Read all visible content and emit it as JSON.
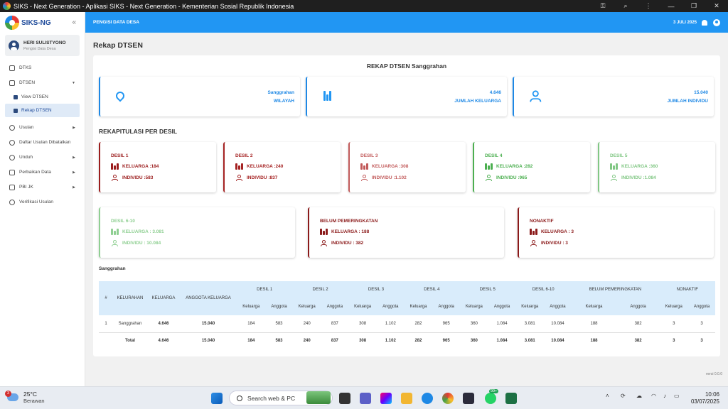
{
  "window": {
    "title": "SIKS - Next Generation - Aplikasi SIKS - Next Generation - Kementerian Sosial Republik Indonesia"
  },
  "sidebar": {
    "logo": "SIKS-NG",
    "user_name": "HERI SULISTYONO",
    "user_role": "Pengisi Data Desa",
    "items": [
      {
        "label": "DTKS"
      },
      {
        "label": "DTSEN"
      },
      {
        "label": "View DTSEN"
      },
      {
        "label": "Rekap DTSEN"
      },
      {
        "label": "Usulan"
      },
      {
        "label": "Daftar Usulan Dibatalkan"
      },
      {
        "label": "Unduh"
      },
      {
        "label": "Perbaikan Data"
      },
      {
        "label": "PBI JK"
      },
      {
        "label": "Verifikasi Usulan"
      }
    ]
  },
  "topbar": {
    "role": "PENGISI DATA DESA",
    "date": "3 JULI 2025"
  },
  "page": {
    "title": "Rekap DTSEN",
    "card_title": "REKAP DTSEN Sanggrahan",
    "section_title": "REKAPITULASI PER DESIL",
    "table_heading": "Sanggrahan",
    "version": "versi 0.0.0"
  },
  "summary": [
    {
      "value": "Sanggrahan",
      "label": "WILAYAH"
    },
    {
      "value": "4.646",
      "label": "JUMLAH KELUARGA"
    },
    {
      "value": "15.040",
      "label": "JUMLAH INDIVIDU"
    }
  ],
  "desil": [
    {
      "name": "DESIL 1",
      "keluarga": "KELUARGA :184",
      "individu": "INDIVIDU :583",
      "color": "#9b1c1c"
    },
    {
      "name": "DESIL 2",
      "keluarga": "KELUARGA :240",
      "individu": "INDIVIDU :837",
      "color": "#a52222"
    },
    {
      "name": "DESIL 3",
      "keluarga": "KELUARGA :308",
      "individu": "INDIVIDU :1.102",
      "color": "#c25b5b"
    },
    {
      "name": "DESIL 4",
      "keluarga": "KELUARGA :282",
      "individu": "INDIVIDU :965",
      "color": "#4caf50"
    },
    {
      "name": "DESIL 5",
      "keluarga": "KELUARGA :360",
      "individu": "INDIVIDU :1.084",
      "color": "#81c784"
    },
    {
      "name": "DESIL 6-10",
      "keluarga": "KELUARGA : 3.081",
      "individu": "INDIVIDU : 10.084",
      "color": "#8fcf92"
    },
    {
      "name": "BELUM PEMERINGKATAN",
      "keluarga": "KELUARGA : 188",
      "individu": "INDIVIDU : 382",
      "color": "#8b1a1a"
    },
    {
      "name": "NONAKTIF",
      "keluarga": "KELUARGA : 3",
      "individu": "INDIVIDU : 3",
      "color": "#8b1a1a"
    }
  ],
  "table": {
    "headers": {
      "no": "#",
      "kelurahan": "KELURAHAN",
      "keluarga": "KELUARGA",
      "anggota": "ANGGOTA KELUARGA"
    },
    "groups": [
      "DESIL 1",
      "DESIL 2",
      "DESIL 3",
      "DESIL 4",
      "DESIL 5",
      "DESIL 6-10",
      "BELUM PEMERINGKATAN",
      "NONAKTIF"
    ],
    "sub": {
      "keluarga": "Keluarga",
      "anggota": "Anggota"
    },
    "rows": [
      {
        "no": "1",
        "kelurahan": "Sanggrahan",
        "keluarga": "4.646",
        "anggota": "15.040",
        "cells": [
          "184",
          "583",
          "240",
          "837",
          "308",
          "1.102",
          "282",
          "965",
          "360",
          "1.084",
          "3.081",
          "10.084",
          "188",
          "382",
          "3",
          "3"
        ]
      },
      {
        "no": "",
        "kelurahan": "Total",
        "keluarga": "4.646",
        "anggota": "15.040",
        "cells": [
          "184",
          "583",
          "240",
          "837",
          "308",
          "1.102",
          "282",
          "965",
          "360",
          "1.084",
          "3.081",
          "10.084",
          "188",
          "382",
          "3",
          "3"
        ]
      }
    ]
  },
  "taskbar": {
    "weather_badge": "3",
    "temperature": "25°C",
    "weather": "Berawan",
    "search_placeholder": "Search web & PC",
    "badge": "99+",
    "time": "10:06",
    "date": "03/07/2025"
  }
}
